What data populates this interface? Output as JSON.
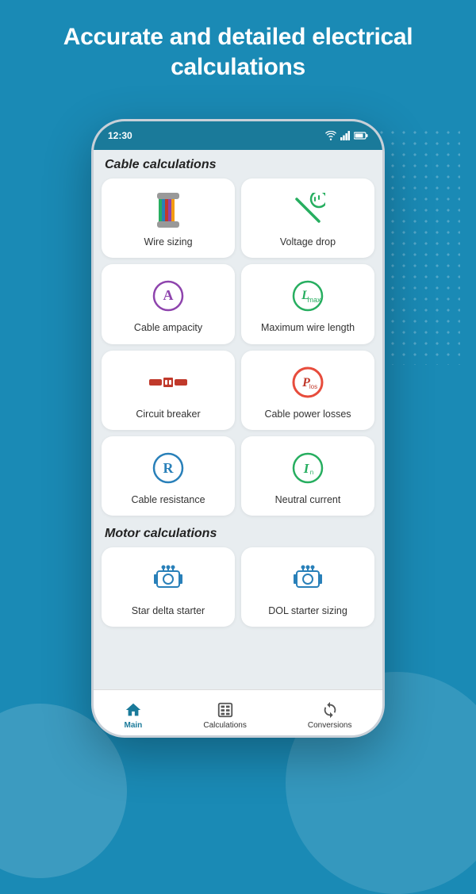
{
  "header": {
    "title": "Accurate and detailed electrical calculations"
  },
  "status_bar": {
    "time": "12:30",
    "wifi": "WiFi",
    "signal": "Signal",
    "battery": "Battery"
  },
  "sections": [
    {
      "label": "Cable calculations",
      "cards": [
        {
          "id": "wire-sizing",
          "label": "Wire sizing",
          "icon": "wire"
        },
        {
          "id": "voltage-drop",
          "label": "Voltage drop",
          "icon": "plug"
        },
        {
          "id": "cable-ampacity",
          "label": "Cable ampacity",
          "icon": "ampacity"
        },
        {
          "id": "max-wire-length",
          "label": "Maximum wire length",
          "icon": "length"
        },
        {
          "id": "circuit-breaker",
          "label": "Circuit breaker",
          "icon": "breaker"
        },
        {
          "id": "cable-power-losses",
          "label": "Cable power losses",
          "icon": "power-loss"
        },
        {
          "id": "cable-resistance",
          "label": "Cable resistance",
          "icon": "resistance"
        },
        {
          "id": "neutral-current",
          "label": "Neutral current",
          "icon": "neutral"
        }
      ]
    },
    {
      "label": "Motor calculations",
      "cards": [
        {
          "id": "star-delta",
          "label": "Star delta starter",
          "icon": "star-delta"
        },
        {
          "id": "dol-starter",
          "label": "DOL starter sizing",
          "icon": "dol"
        }
      ]
    }
  ],
  "nav": [
    {
      "id": "main",
      "label": "Main",
      "icon": "home",
      "active": true
    },
    {
      "id": "calculations",
      "label": "Calculations",
      "icon": "calc",
      "active": false
    },
    {
      "id": "conversions",
      "label": "Conversions",
      "icon": "convert",
      "active": false
    }
  ]
}
